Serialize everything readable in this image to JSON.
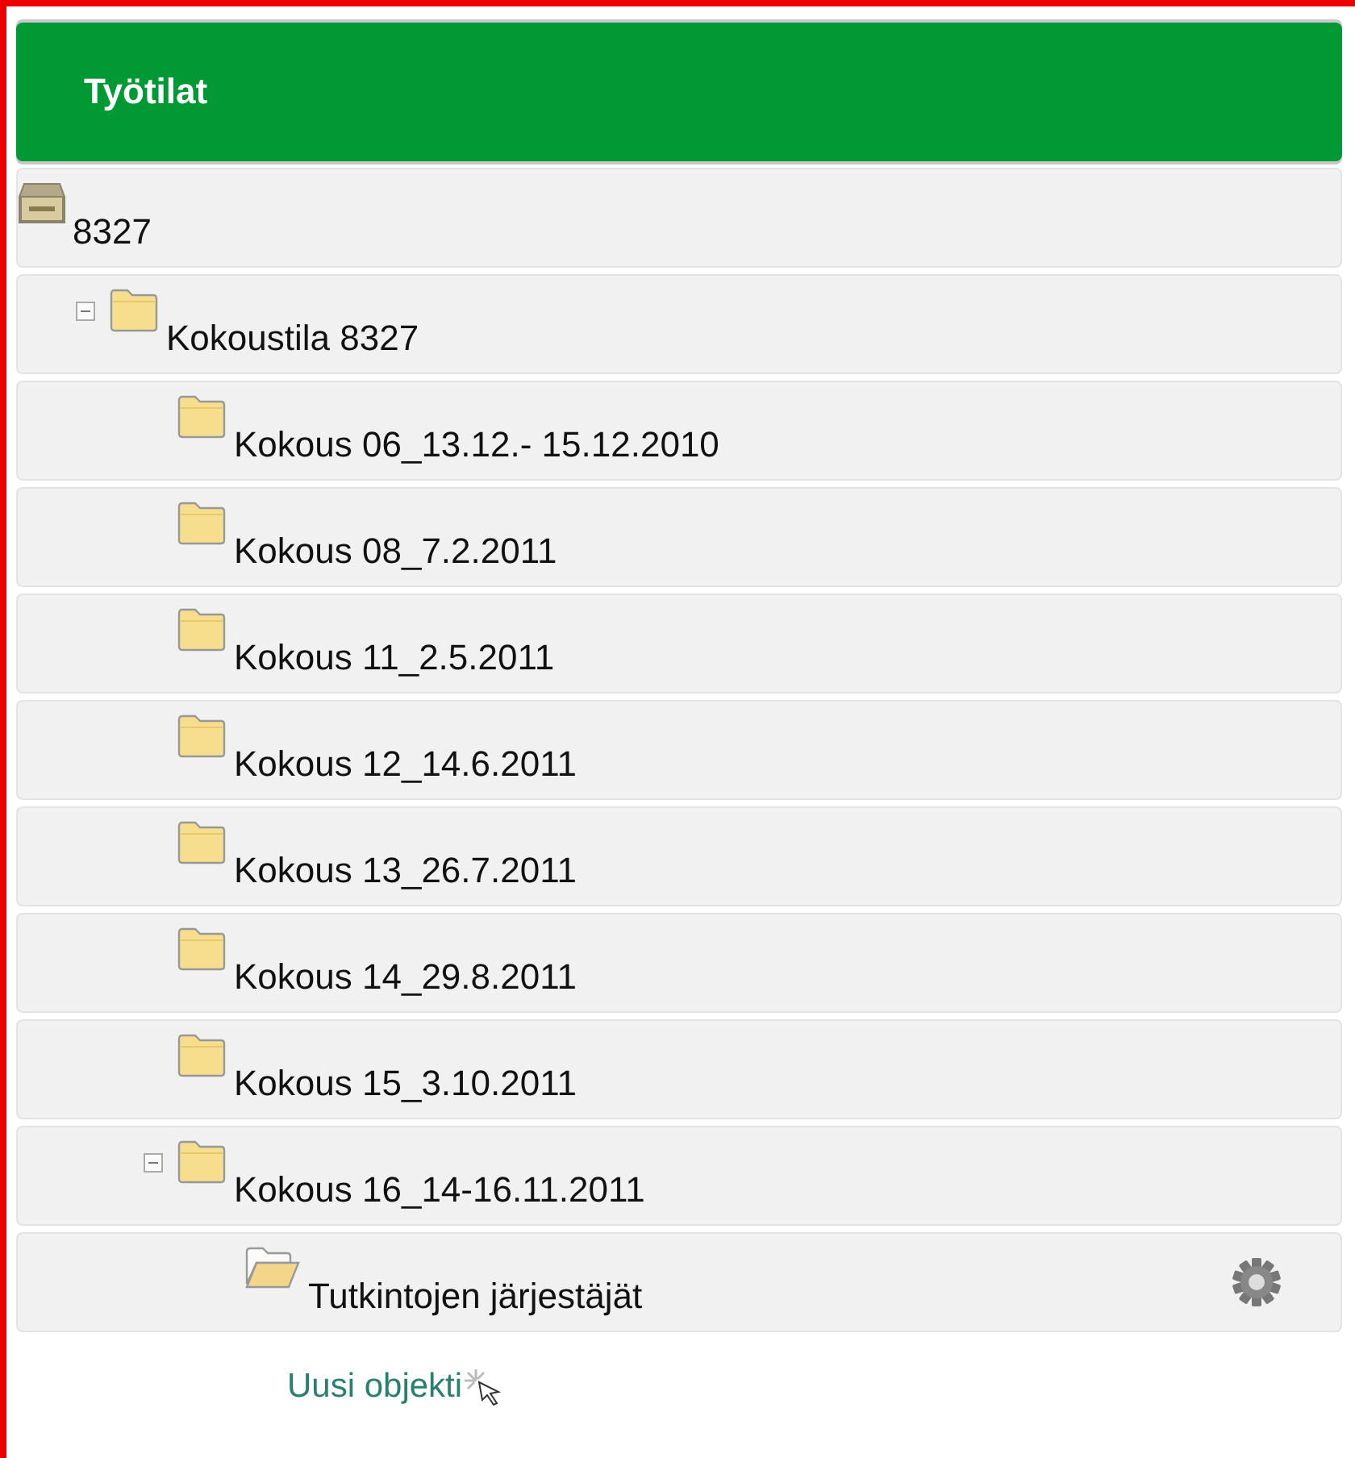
{
  "panel": {
    "title": "Työtilat"
  },
  "tree": [
    {
      "label": "8327",
      "kind": "drive",
      "children": [
        {
          "label": "Kokoustila 8327",
          "kind": "folder",
          "expanded": true,
          "children": [
            {
              "label": "Kokous 06_13.12.- 15.12.2010",
              "kind": "folder"
            },
            {
              "label": "Kokous 08_7.2.2011",
              "kind": "folder"
            },
            {
              "label": "Kokous 11_2.5.2011",
              "kind": "folder"
            },
            {
              "label": "Kokous 12_14.6.2011",
              "kind": "folder"
            },
            {
              "label": "Kokous 13_26.7.2011",
              "kind": "folder"
            },
            {
              "label": "Kokous 14_29.8.2011",
              "kind": "folder"
            },
            {
              "label": "Kokous 15_3.10.2011",
              "kind": "folder"
            },
            {
              "label": "Kokous 16_14-16.11.2011",
              "kind": "folder",
              "expanded": true,
              "children": [
                {
                  "label": "Tutkintojen järjestäjät",
                  "kind": "open-folder",
                  "settings": true
                }
              ]
            }
          ]
        }
      ]
    }
  ],
  "new_object_link": "Uusi objekti"
}
